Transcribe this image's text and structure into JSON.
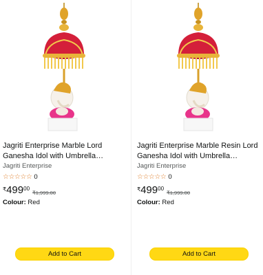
{
  "products": [
    {
      "title": "Jagriti Enterprise Marble Lord Ganesha Idol with Umbrella showpiece for car…",
      "brand": "Jagriti Enterprise",
      "stars_icon": "star-outline-icon",
      "stars": "☆☆☆☆☆",
      "rating_count": "0",
      "currency": "₹",
      "price_whole": "499",
      "price_fraction": "00",
      "mrp": "₹1,999.00",
      "colour_label": "Colour:",
      "colour_value": "Red",
      "add_to_cart": "Add to Cart"
    },
    {
      "title": "Jagriti Enterprise Marble Resin Lord Ganesha Idol with Umbrella showpiec…",
      "brand": "Jagriti Enterprise",
      "stars_icon": "star-outline-icon",
      "stars": "☆☆☆☆☆",
      "rating_count": "0",
      "currency": "₹",
      "price_whole": "499",
      "price_fraction": "00",
      "mrp": "₹1,999.00",
      "colour_label": "Colour:",
      "colour_value": "Red",
      "add_to_cart": "Add to Cart"
    }
  ],
  "colors": {
    "button": "#ffd814",
    "star": "#de7921",
    "umbrella": "#d41f3a",
    "gold": "#e0a32a",
    "idol_pink": "#e8348a"
  }
}
